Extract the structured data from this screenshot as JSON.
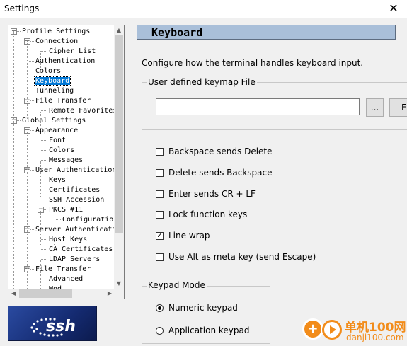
{
  "window": {
    "title": "Settings",
    "close_glyph": "✕"
  },
  "tree": {
    "items": [
      {
        "label": "Profile Settings",
        "expander": "−"
      },
      {
        "label": "Connection",
        "expander": "−"
      },
      {
        "label": "Cipher List"
      },
      {
        "label": "Authentication"
      },
      {
        "label": "Colors"
      },
      {
        "label": "Keyboard",
        "selected": true
      },
      {
        "label": "Tunneling"
      },
      {
        "label": "File Transfer",
        "expander": "−"
      },
      {
        "label": "Remote Favorites"
      },
      {
        "label": "Global Settings",
        "expander": "−"
      },
      {
        "label": "Appearance",
        "expander": "−"
      },
      {
        "label": "Font"
      },
      {
        "label": "Colors"
      },
      {
        "label": "Messages"
      },
      {
        "label": "User Authentication",
        "expander": "−"
      },
      {
        "label": "Keys"
      },
      {
        "label": "Certificates"
      },
      {
        "label": "SSH Accession"
      },
      {
        "label": "PKCS #11",
        "expander": "−"
      },
      {
        "label": "Configuration"
      },
      {
        "label": "Server Authentication",
        "expander": "−"
      },
      {
        "label": "Host Keys"
      },
      {
        "label": "CA Certificates"
      },
      {
        "label": "LDAP Servers"
      },
      {
        "label": "File Transfer",
        "expander": "−"
      },
      {
        "label": "Advanced"
      },
      {
        "label": "Mod"
      }
    ],
    "scroll_up": "▲",
    "scroll_down": "▼",
    "scroll_left": "◀",
    "scroll_right": "▶"
  },
  "logo": {
    "text": "ssh"
  },
  "panel": {
    "heading": "Keyboard",
    "description": "Configure how the terminal handles keyboard input.",
    "keymap_group_label": "User defined keymap File",
    "keymap_file_value": "",
    "browse_label": "...",
    "edit_label": "Edit",
    "checkboxes": [
      {
        "label": "Backspace sends Delete",
        "checked": false
      },
      {
        "label": "Delete sends Backspace",
        "checked": false
      },
      {
        "label": "Enter sends CR + LF",
        "checked": false
      },
      {
        "label": "Lock function keys",
        "checked": false
      },
      {
        "label": "Line wrap",
        "checked": true
      },
      {
        "label": "Use Alt as meta key (send Escape)",
        "checked": false
      }
    ],
    "keypad_group_label": "Keypad Mode",
    "radios": [
      {
        "label": "Numeric keypad",
        "selected": true
      },
      {
        "label": "Application keypad",
        "selected": false
      }
    ],
    "check_glyph": "✓"
  },
  "watermark": {
    "cn": "单机100网",
    "domain": "danji100.com",
    "plus": "+"
  },
  "colors": {
    "selection": "#0078d7",
    "header_bg": "#a9bfd9",
    "logo_bg": "#1b2d6e",
    "watermark": "#f28c1a"
  }
}
